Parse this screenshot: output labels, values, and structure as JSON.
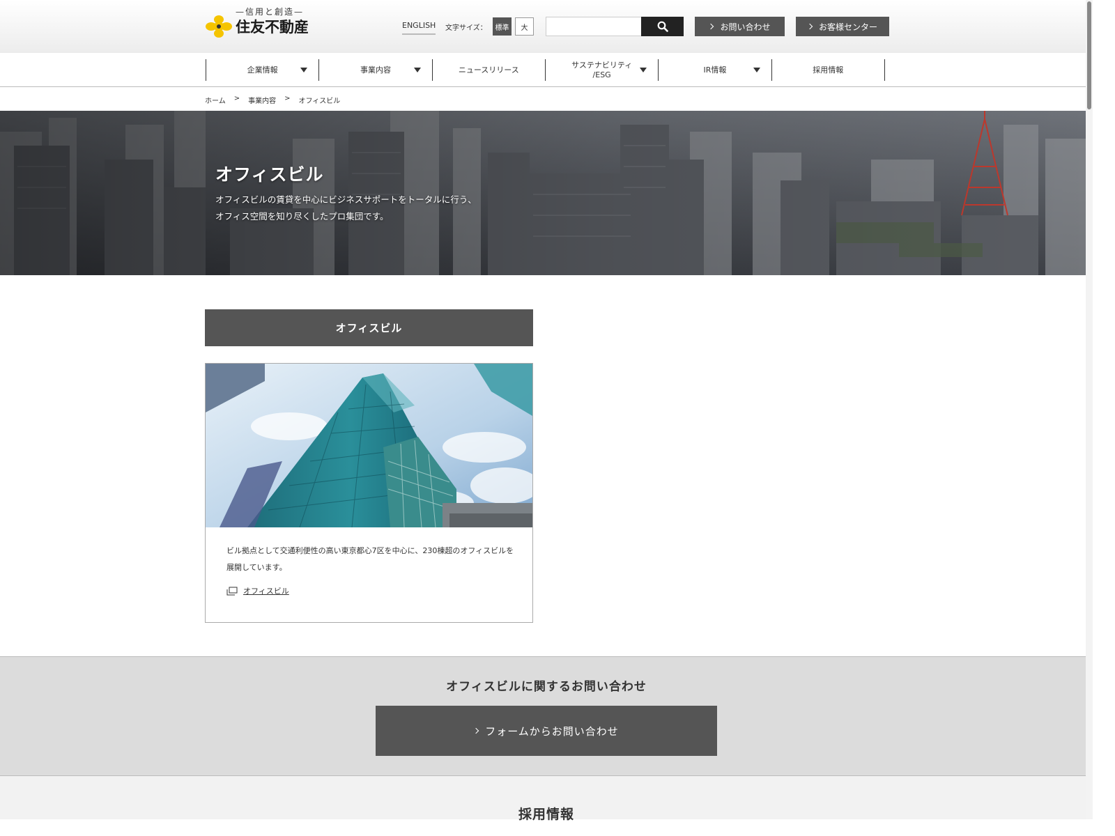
{
  "header": {
    "tagline": "—信用と創造—",
    "company": "住友不動産",
    "english_label": "ENGLISH",
    "font_size_label": "文字サイズ：",
    "font_standard": "標準",
    "font_large": "大",
    "search_placeholder": "",
    "contact_label": "お問い合わせ",
    "customer_center_label": "お客様センター",
    "brand_color": "#f5c400"
  },
  "nav": {
    "items": [
      {
        "label": "企業情報",
        "dropdown": true
      },
      {
        "label": "事業内容",
        "dropdown": true
      },
      {
        "label": "ニュースリリース",
        "dropdown": false
      },
      {
        "label": "サステナビリティ\n/ESG",
        "dropdown": true
      },
      {
        "label": "IR情報",
        "dropdown": true
      },
      {
        "label": "採用情報",
        "dropdown": false
      }
    ]
  },
  "breadcrumb": {
    "items": [
      "ホーム",
      "事業内容",
      "オフィスビル"
    ],
    "separator": ">"
  },
  "hero": {
    "title": "オフィスビル",
    "description_line1": "オフィスビルの賃貸を中心にビジネスサポートをトータルに行う、",
    "description_line2": "オフィス空間を知り尽くしたプロ集団です。"
  },
  "section": {
    "heading": "オフィスビル"
  },
  "card": {
    "description": "ビル拠点として交通利便性の高い東京都心7区を中心に、230棟超のオフィスビルを展開しています。",
    "link_label": "オフィスビル"
  },
  "contact": {
    "title": "オフィスビルに関するお問い合わせ",
    "button_label": "フォームからお問い合わせ"
  },
  "recruit": {
    "title": "採用情報"
  }
}
